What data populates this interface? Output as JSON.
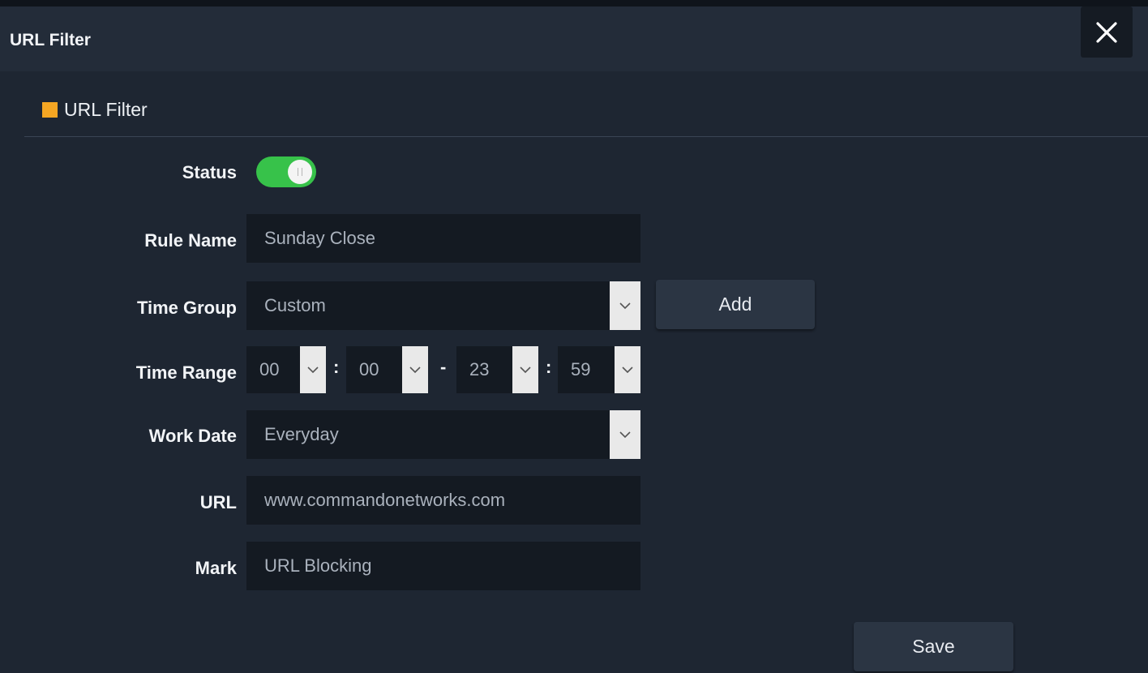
{
  "dialog": {
    "title": "URL Filter",
    "close_icon": "close-icon"
  },
  "section": {
    "title": "URL Filter",
    "marker_color": "#f5a623"
  },
  "form": {
    "status": {
      "label": "Status",
      "enabled": true,
      "on_color": "#37c24a"
    },
    "rule_name": {
      "label": "Rule Name",
      "value": "Sunday Close"
    },
    "time_group": {
      "label": "Time Group",
      "value": "Custom",
      "add_label": "Add"
    },
    "time_range": {
      "label": "Time Range",
      "start_hour": "00",
      "start_minute": "00",
      "end_hour": "23",
      "end_minute": "59",
      "colon": ":",
      "dash": "-"
    },
    "work_date": {
      "label": "Work Date",
      "value": "Everyday"
    },
    "url": {
      "label": "URL",
      "value": "www.commandonetworks.com"
    },
    "mark": {
      "label": "Mark",
      "value": "URL Blocking"
    }
  },
  "footer": {
    "save_label": "Save"
  }
}
